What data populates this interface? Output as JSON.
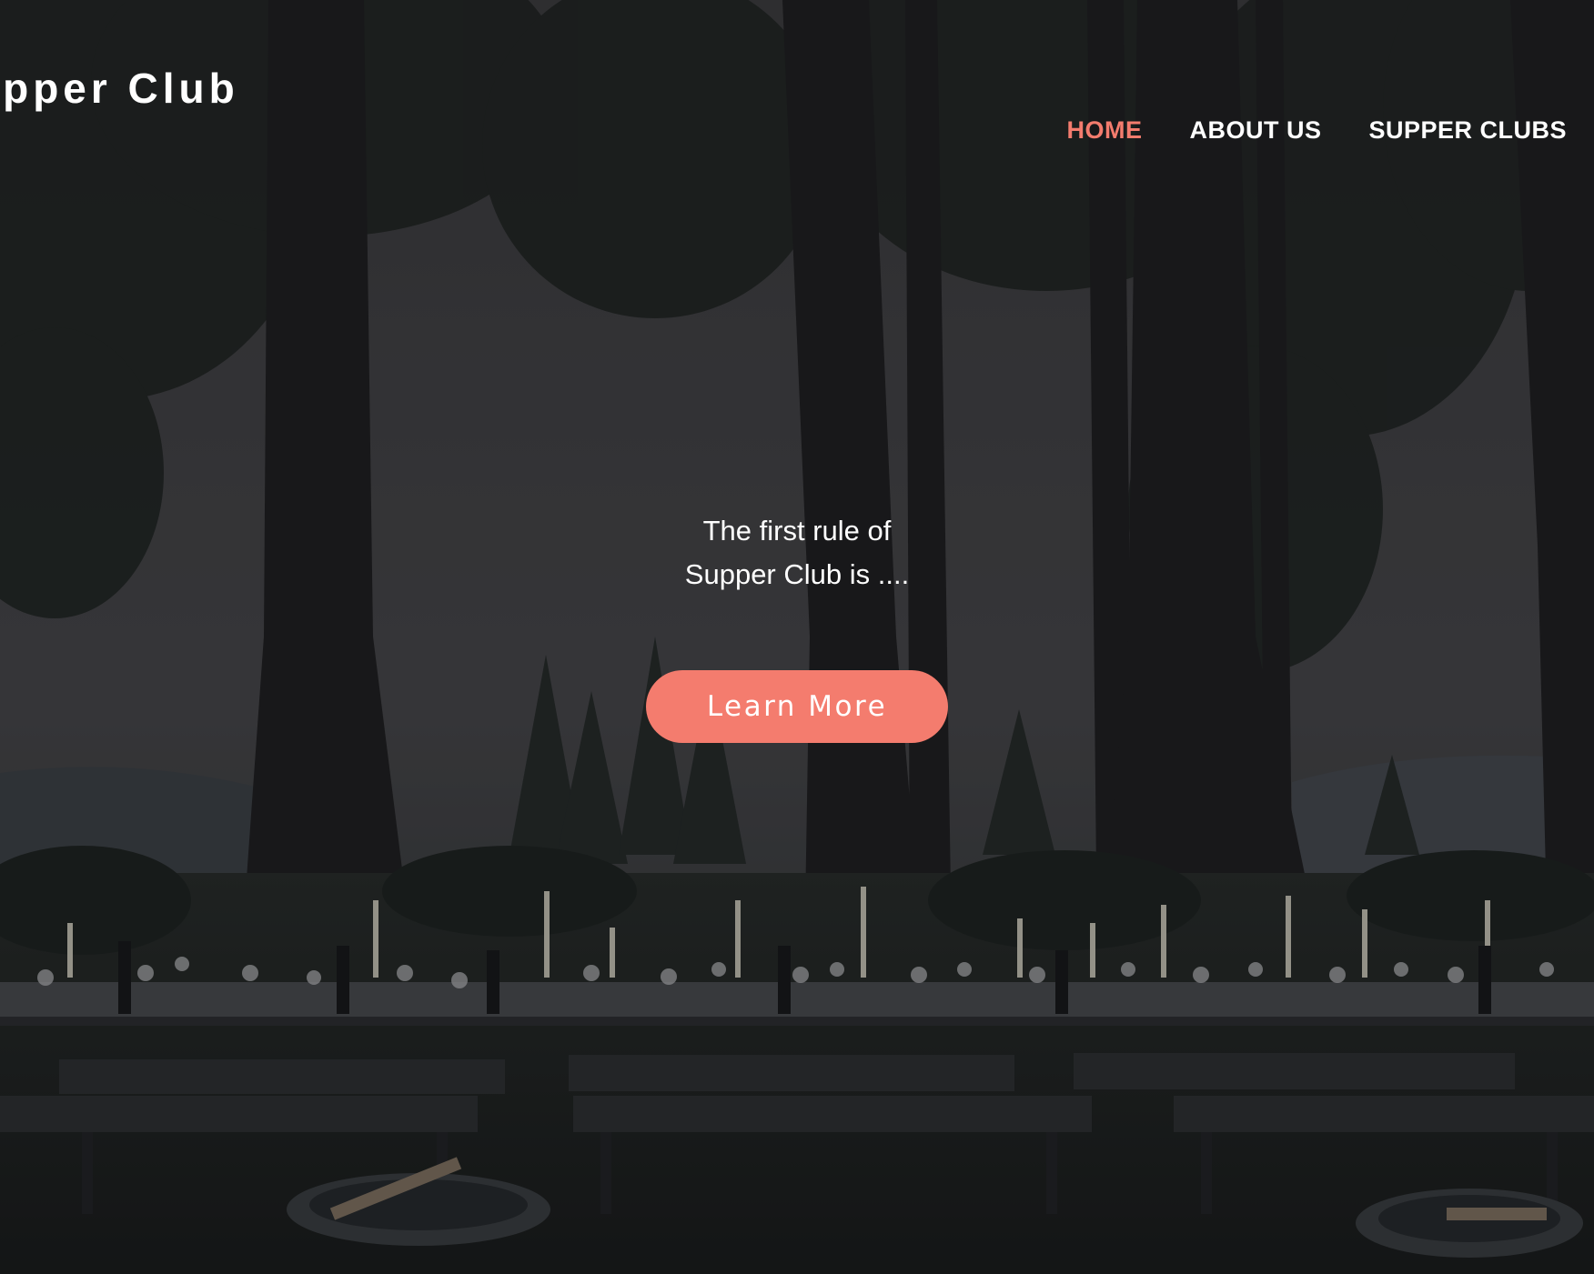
{
  "header": {
    "site_title": "upper Club",
    "nav": {
      "home": "HOME",
      "about": "ABOUT US",
      "supper_clubs": "SUPPER CLUBS"
    }
  },
  "hero": {
    "line1": "The first rule of",
    "line2": "Supper Club is ....",
    "cta_label": "Learn More"
  },
  "colors": {
    "accent": "#f47c6e",
    "text": "#ffffff",
    "overlay": "#2a2a2c"
  }
}
